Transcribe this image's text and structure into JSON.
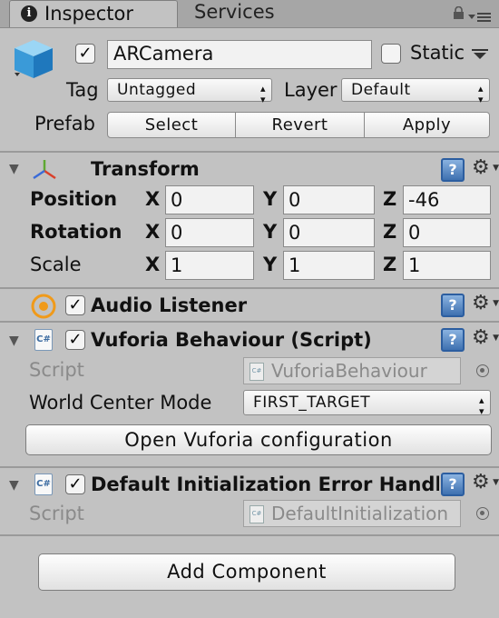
{
  "tabs": {
    "inspector": "Inspector",
    "services": "Services"
  },
  "object": {
    "active": true,
    "name": "ARCamera",
    "static_label": "Static",
    "static_checked": false,
    "tag_label": "Tag",
    "tag_value": "Untagged",
    "layer_label": "Layer",
    "layer_value": "Default",
    "prefab_label": "Prefab",
    "prefab_buttons": {
      "select": "Select",
      "revert": "Revert",
      "apply": "Apply"
    }
  },
  "transform": {
    "title": "Transform",
    "position_label": "Position",
    "rotation_label": "Rotation",
    "scale_label": "Scale",
    "axis": {
      "x": "X",
      "y": "Y",
      "z": "Z"
    },
    "position": {
      "x": "0",
      "y": "0",
      "z": "-46"
    },
    "rotation": {
      "x": "0",
      "y": "0",
      "z": "0"
    },
    "scale": {
      "x": "1",
      "y": "1",
      "z": "1"
    }
  },
  "audio_listener": {
    "title": "Audio Listener",
    "enabled": true
  },
  "vuforia": {
    "title": "Vuforia Behaviour (Script)",
    "enabled": true,
    "script_label": "Script",
    "script_value": "VuforiaBehaviour",
    "world_center_label": "World Center Mode",
    "world_center_value": "FIRST_TARGET",
    "config_button": "Open Vuforia configuration"
  },
  "default_init": {
    "title": "Default Initialization Error Handle",
    "enabled": true,
    "script_label": "Script",
    "script_value": "DefaultInitialization"
  },
  "add_component": "Add Component",
  "glyphs": {
    "check": "✓",
    "help": "?",
    "gear": "⚙",
    "foldout": "▼",
    "cs": "C#",
    "info": "i"
  },
  "colors": {
    "panel": "#c2c2c2",
    "tabbar": "#a6a6a6",
    "help_blue": "#3e70b0"
  }
}
